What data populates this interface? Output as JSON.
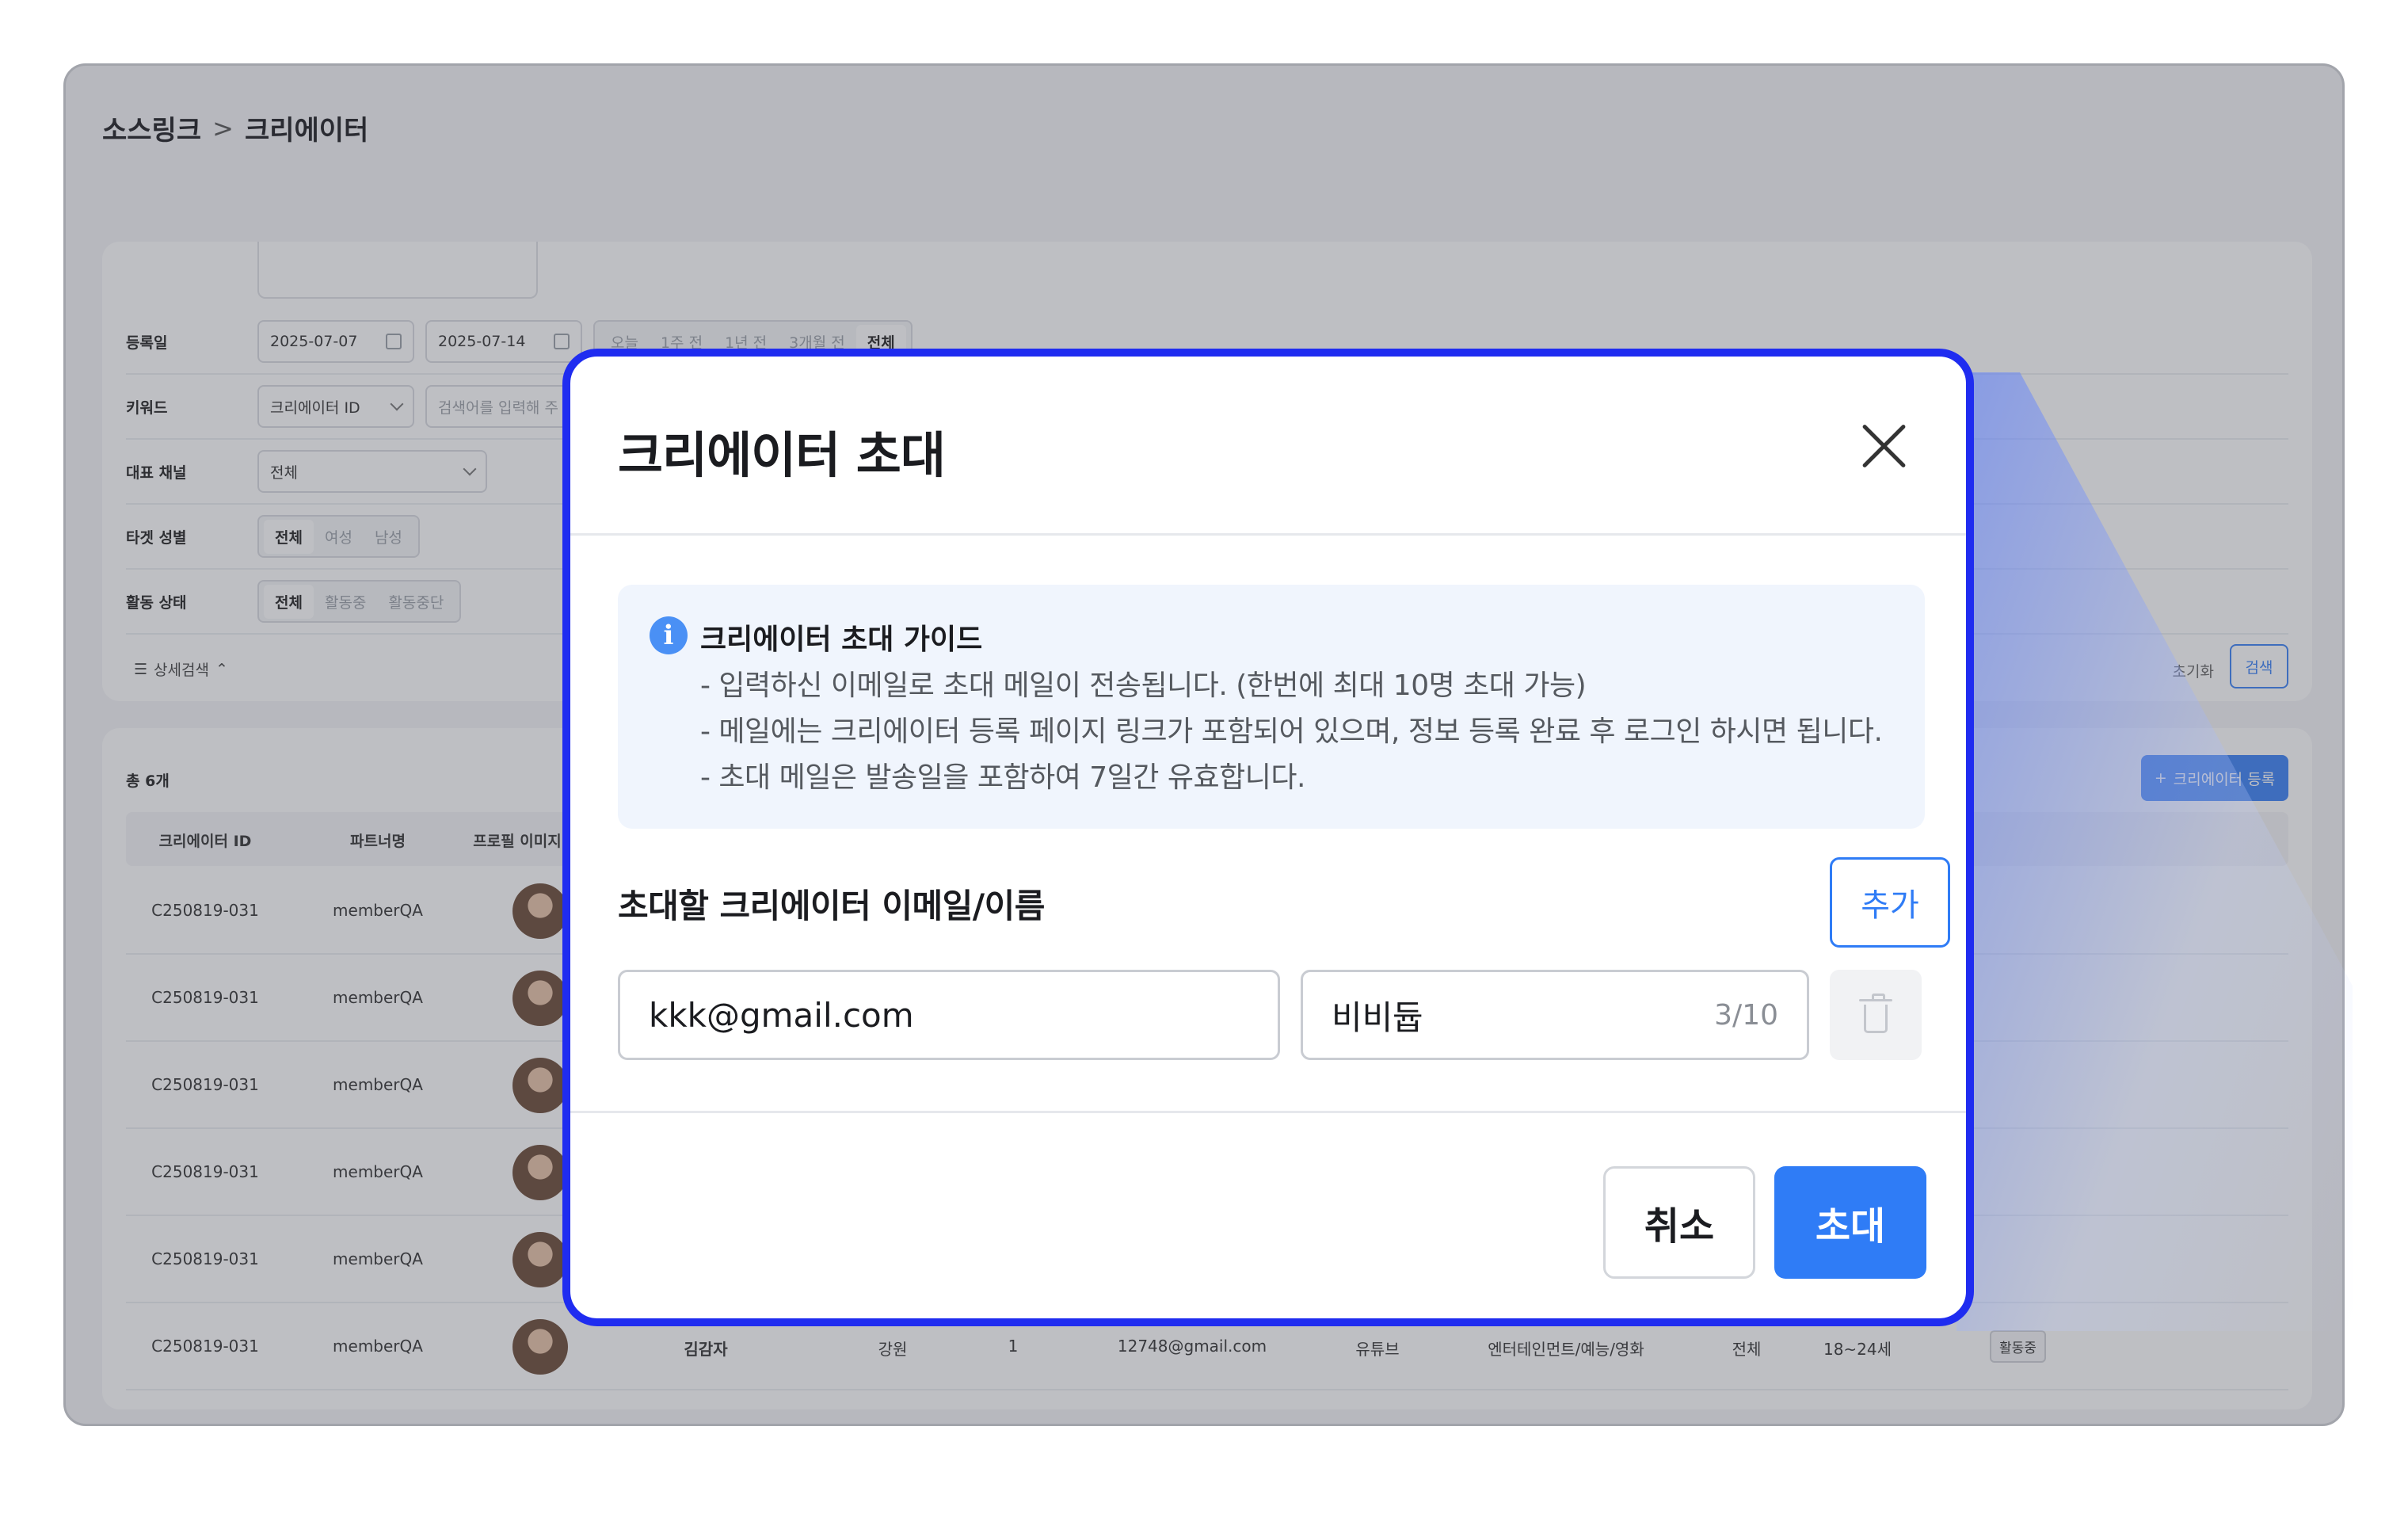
{
  "breadcrumb": {
    "root": "소스링크",
    "separator": ">",
    "current": "크리에이터"
  },
  "filters": {
    "reg_date": {
      "label": "등록일",
      "start": "2025-07-07",
      "end": "2025-07-14",
      "periods": [
        "오늘",
        "1주 전",
        "1년 전",
        "3개월 전",
        "전체"
      ],
      "selected_period": "전체"
    },
    "keyword": {
      "label": "키워드",
      "type_value": "크리에이터 ID",
      "placeholder": "검색어를 입력해 주"
    },
    "channel": {
      "label": "대표 채널",
      "value": "전체"
    },
    "gender": {
      "label": "타겟 성별",
      "options": [
        "전체",
        "여성",
        "남성"
      ],
      "selected": "전체"
    },
    "status": {
      "label": "활동 상태",
      "options": [
        "전체",
        "활동중",
        "활동중단"
      ],
      "selected": "전체"
    },
    "detail_toggle": "상세검색",
    "reset": "초기화",
    "search": "검색"
  },
  "list": {
    "total": "총 6개",
    "register_button": "크리에이터 등록",
    "columns": [
      "크리에이터 ID",
      "파트너명",
      "프로필 이미지"
    ],
    "rows": [
      {
        "id": "C250819-031",
        "partner": "memberQA"
      },
      {
        "id": "C250819-031",
        "partner": "memberQA"
      },
      {
        "id": "C250819-031",
        "partner": "memberQA"
      },
      {
        "id": "C250819-031",
        "partner": "memberQA"
      },
      {
        "id": "C250819-031",
        "partner": "memberQA"
      }
    ],
    "last_row": {
      "id": "C250819-031",
      "partner": "memberQA",
      "name": "김감자",
      "region": "강원",
      "count": "1",
      "email": "12748@gmail.com",
      "channel": "유튜브",
      "category": "엔터테인먼트/예능/영화",
      "gender": "전체",
      "age": "18~24세",
      "status": "활동중"
    }
  },
  "modal": {
    "title": "크리에이터 초대",
    "guide": {
      "title": "크리에이터 초대 가이드",
      "lines": [
        "- 입력하신 이메일로 초대 메일이 전송됩니다. (한번에 최대 10명 초대 가능)",
        "- 메일에는 크리에이터 등록 페이지 링크가 포함되어 있으며, 정보 등록 완료 후 로그인 하시면 됩니다.",
        "- 초대 메일은 발송일을 포함하여 7일간 유효합니다."
      ]
    },
    "section_label": "초대할 크리에이터 이메일/이름",
    "add_button": "추가",
    "email_value": "kkk@gmail.com",
    "name_value": "비비듑",
    "name_counter": "3/10",
    "cancel_button": "취소",
    "invite_button": "초대"
  }
}
